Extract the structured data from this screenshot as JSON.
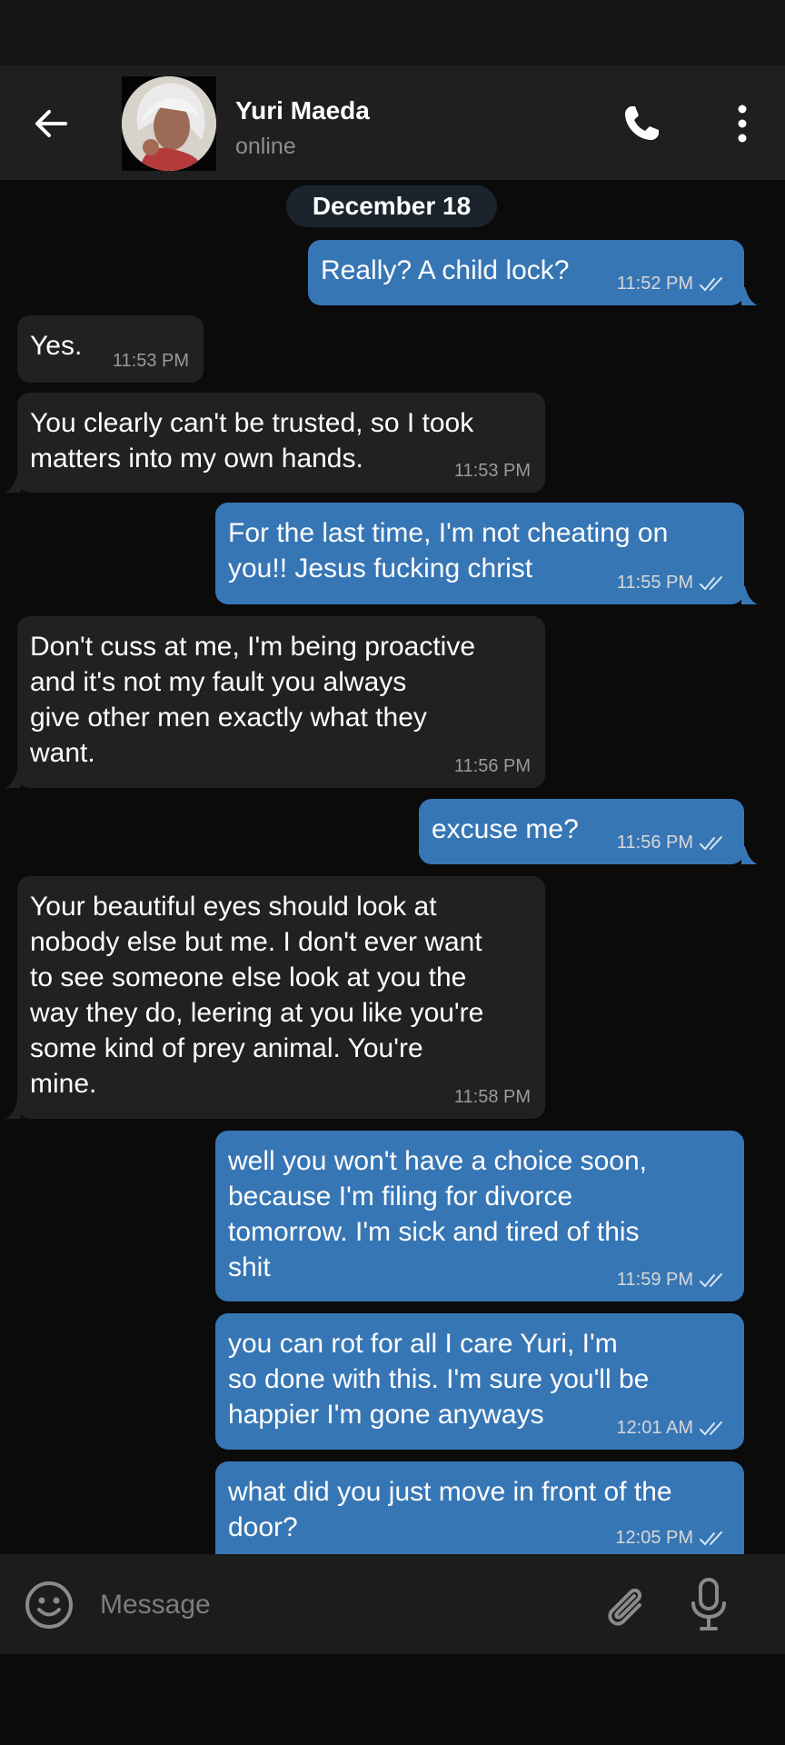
{
  "header": {
    "contact_name": "Yuri Maeda",
    "contact_status": "online"
  },
  "date_separator": "December 18",
  "messages": [
    {
      "direction": "out",
      "text": "Really? A child lock?",
      "time": "11:52 PM"
    },
    {
      "direction": "in",
      "text": "Yes.",
      "time": "11:53 PM"
    },
    {
      "direction": "in",
      "text": "You clearly can't be trusted, so I took\nmatters into my own hands.",
      "time": "11:53 PM"
    },
    {
      "direction": "out",
      "text": "For the last time, I'm not cheating on\nyou!! Jesus fucking christ",
      "time": "11:55 PM"
    },
    {
      "direction": "in",
      "text": "Don't cuss at me, I'm being proactive\nand it's not my fault you always\ngive other men exactly what they\nwant.",
      "time": "11:56 PM"
    },
    {
      "direction": "out",
      "text": "excuse me?",
      "time": "11:56 PM"
    },
    {
      "direction": "in",
      "text": "Your beautiful eyes should look at\nnobody else but me. I don't ever want\nto see someone else look at you the\nway they do, leering at you like you're\nsome kind of prey animal. You're\nmine.",
      "time": "11:58 PM"
    },
    {
      "direction": "out",
      "text": "well you won't have a choice soon,\nbecause I'm filing for divorce\ntomorrow. I'm sick and tired of this\nshit",
      "time": "11:59 PM"
    },
    {
      "direction": "out",
      "text": "you can rot for all I care Yuri, I'm\nso done with this. I'm sure you'll be\nhappier I'm gone anyways",
      "time": "12:01 AM"
    },
    {
      "direction": "out",
      "text": "what did you just move in front of the\ndoor?",
      "time": "12:05 PM"
    }
  ],
  "composer": {
    "placeholder": "Message"
  },
  "icons": {
    "back": "arrow-left-icon",
    "call": "phone-icon",
    "menu": "more-vertical-icon",
    "emoji": "smiley-icon",
    "attach": "paperclip-icon",
    "mic": "microphone-icon",
    "read_receipt": "double-check-icon"
  },
  "colors": {
    "outgoing_bubble": "#3776b5",
    "incoming_bubble": "#212121",
    "header": "#1f1f1f",
    "background": "#0b0b0b"
  }
}
